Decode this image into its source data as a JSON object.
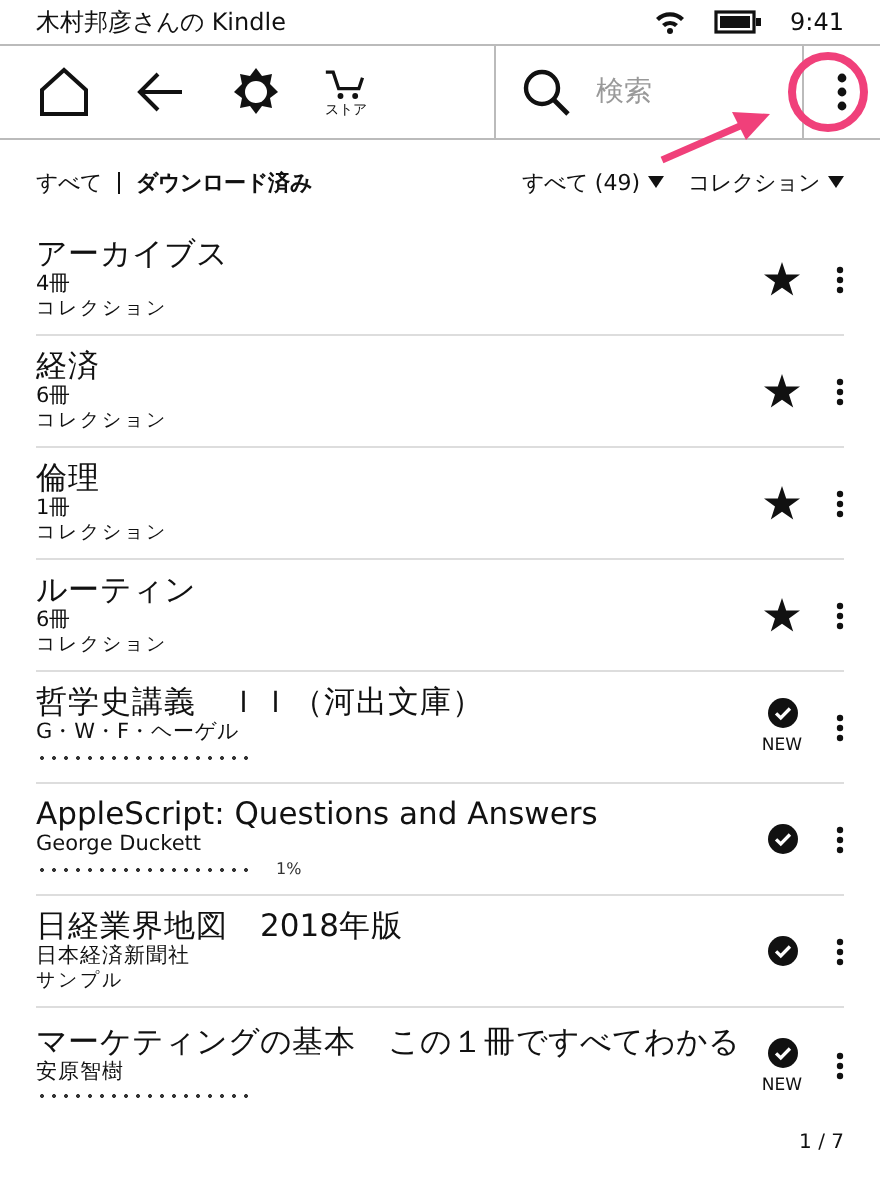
{
  "status_bar": {
    "device_name": "木村邦彦さんの Kindle",
    "time": "9:41"
  },
  "toolbar": {
    "store_label": "ストア",
    "search": {
      "placeholder": "検索"
    }
  },
  "filters": {
    "tabs": [
      {
        "label": "すべて",
        "selected": false
      },
      {
        "label": "ダウンロード済み",
        "selected": true
      }
    ],
    "dropdowns": [
      {
        "label": "すべて (49)"
      },
      {
        "label": "コレクション"
      }
    ]
  },
  "items": [
    {
      "kind": "collection",
      "title": "アーカイブス",
      "count": "4冊",
      "label": "コレクション",
      "starred": true
    },
    {
      "kind": "collection",
      "title": "経済",
      "count": "6冊",
      "label": "コレクション",
      "starred": true
    },
    {
      "kind": "collection",
      "title": "倫理",
      "count": "1冊",
      "label": "コレクション",
      "starred": true
    },
    {
      "kind": "collection",
      "title": "ルーティン",
      "count": "6冊",
      "label": "コレクション",
      "starred": true
    },
    {
      "kind": "book",
      "title": "哲学史講義　ＩＩ（河出文庫）",
      "author": "G・W・F・ヘーゲル",
      "footer": {
        "kind": "dots"
      },
      "downloaded": true,
      "new_badge": "NEW"
    },
    {
      "kind": "book",
      "title": "AppleScript: Questions and Answers",
      "author": "George Duckett",
      "footer": {
        "kind": "dots",
        "reading": "1%"
      },
      "downloaded": true
    },
    {
      "kind": "book",
      "title": "日経業界地図　2018年版",
      "author": "日本経済新聞社",
      "footer": {
        "kind": "text",
        "text": "サンプル"
      },
      "downloaded": true
    },
    {
      "kind": "book",
      "title": "マーケティングの基本　この１冊ですべてわかる",
      "author": "安原智樹",
      "footer": {
        "kind": "dots"
      },
      "downloaded": true,
      "new_badge": "NEW"
    }
  ],
  "page_indicator": "1 / 7"
}
